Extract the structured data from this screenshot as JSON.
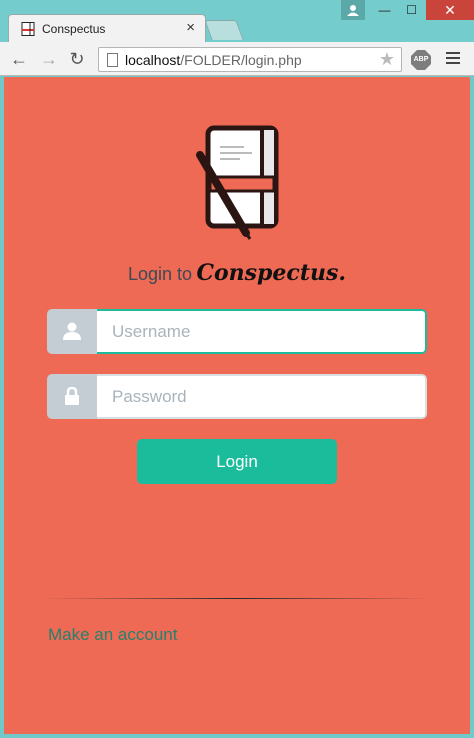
{
  "browser": {
    "tab_title": "Conspectus",
    "tab_close": "×",
    "url_host": "localhost",
    "url_path": "/FOLDER/login.php",
    "extension_badge": "ABP",
    "window_controls": {
      "minimize": "—",
      "maximize": "☐",
      "close": "✕"
    }
  },
  "login": {
    "title_prefix": "Login to",
    "brand_name": "Conspectus.",
    "username_placeholder": "Username",
    "password_placeholder": "Password",
    "submit_label": "Login",
    "signup_link": "Make an account"
  },
  "colors": {
    "page_background": "#ef6a55",
    "accent": "#1abc9c",
    "link": "#23826e",
    "addon_gray": "#c4cdd4"
  },
  "icons": [
    "notebook-logo-icon",
    "user-icon",
    "lock-icon",
    "back-arrow-icon",
    "forward-arrow-icon",
    "reload-icon",
    "page-icon",
    "star-icon",
    "menu-icon"
  ]
}
